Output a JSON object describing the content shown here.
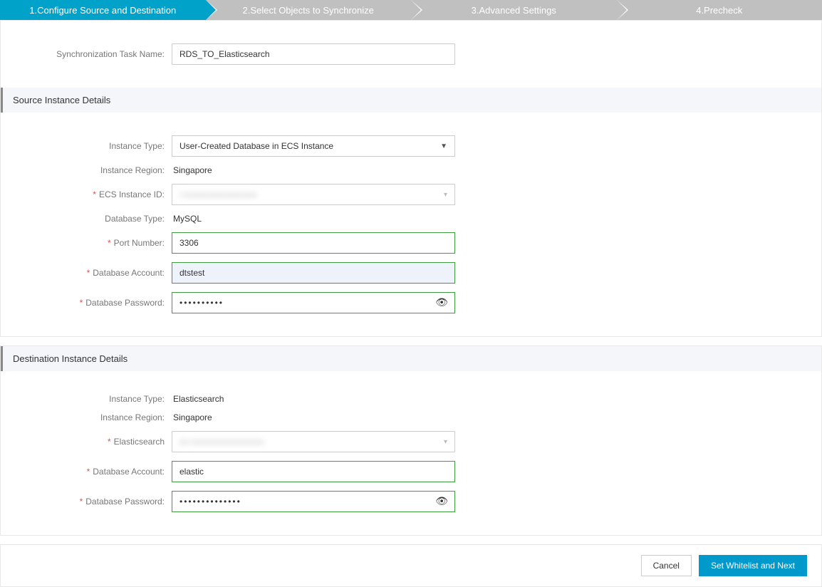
{
  "steps": {
    "s1": "1.Configure Source and Destination",
    "s2": "2.Select Objects to Synchronize",
    "s3": "3.Advanced Settings",
    "s4": "4.Precheck"
  },
  "taskName": {
    "label": "Synchronization Task Name:",
    "value": "RDS_TO_Elasticsearch"
  },
  "source": {
    "header": "Source Instance Details",
    "instanceType": {
      "label": "Instance Type:",
      "value": "User-Created Database in ECS Instance"
    },
    "instanceRegion": {
      "label": "Instance Region:",
      "value": "Singapore"
    },
    "ecsInstanceId": {
      "label": "ECS Instance ID:",
      "value": "i-xxxxxxxxxxxxxxxxx"
    },
    "databaseType": {
      "label": "Database Type:",
      "value": "MySQL"
    },
    "portNumber": {
      "label": "Port Number:",
      "value": "3306"
    },
    "dbAccount": {
      "label": "Database Account:",
      "value": "dtstest"
    },
    "dbPassword": {
      "label": "Database Password:",
      "value": "••••••••••"
    }
  },
  "dest": {
    "header": "Destination Instance Details",
    "instanceType": {
      "label": "Instance Type:",
      "value": "Elasticsearch"
    },
    "instanceRegion": {
      "label": "Instance Region:",
      "value": "Singapore"
    },
    "elasticsearch": {
      "label": "Elasticsearch",
      "value": "es-xxxxxxxxxxxxxxxxx"
    },
    "dbAccount": {
      "label": "Database Account:",
      "value": "elastic"
    },
    "dbPassword": {
      "label": "Database Password:",
      "value": "••••••••••••••"
    }
  },
  "footer": {
    "cancel": "Cancel",
    "next": "Set Whitelist and Next"
  }
}
